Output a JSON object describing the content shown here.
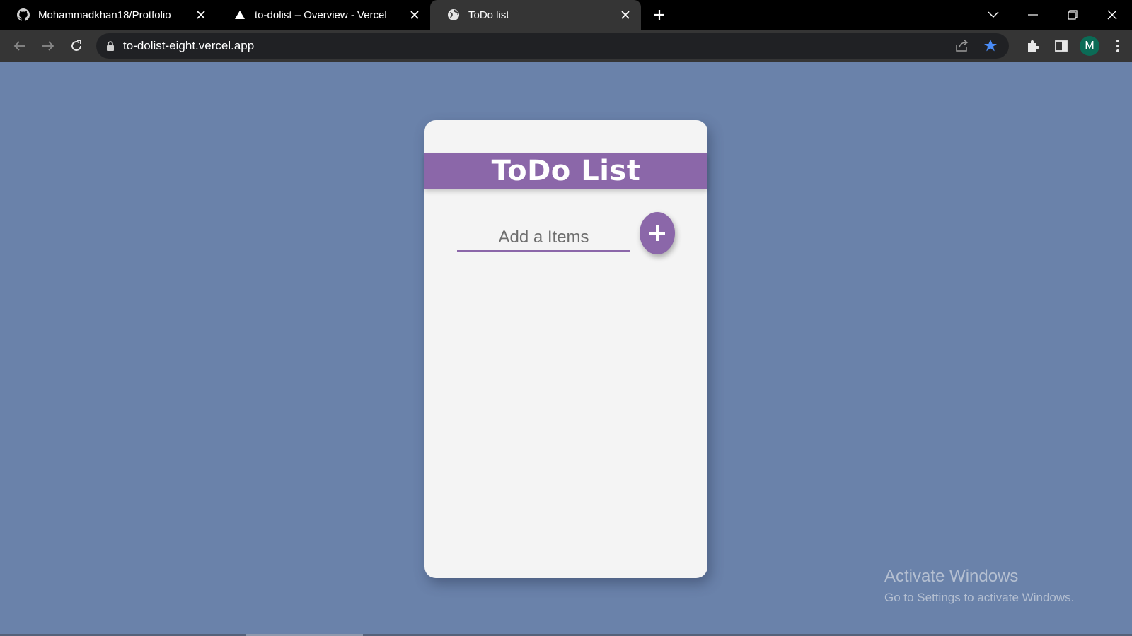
{
  "browser": {
    "tabs": [
      {
        "title": "Mohammadkhan18/Protfolio",
        "icon": "github-icon"
      },
      {
        "title": "to-dolist – Overview - Vercel",
        "icon": "vercel-icon"
      },
      {
        "title": "ToDo list",
        "icon": "globe-icon"
      }
    ],
    "url": "to-dolist-eight.vercel.app",
    "profile_initial": "M",
    "colors": {
      "tabstrip": "#000000",
      "toolbar": "#353535",
      "bookmark_star": "#4a8cf7",
      "avatar": "#0b6b56"
    }
  },
  "app": {
    "title": "ToDo List",
    "input_placeholder": "Add a Items",
    "add_button_label": "+",
    "colors": {
      "page_background": "#6a82aa",
      "accent": "#8b67a9",
      "card": "#f4f4f4"
    }
  },
  "watermark": {
    "line1": "Activate Windows",
    "line2": "Go to Settings to activate Windows."
  }
}
